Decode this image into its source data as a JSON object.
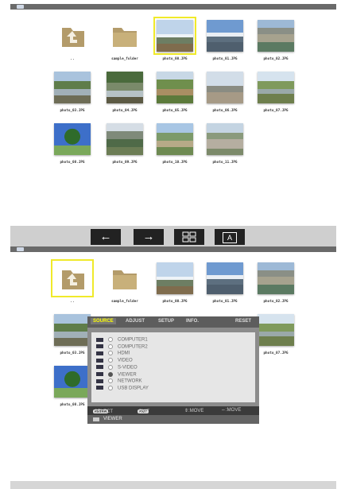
{
  "files_top": [
    {
      "label": "..",
      "kind": "up",
      "selected": false
    },
    {
      "label": "sample_folder",
      "kind": "folder",
      "selected": false
    },
    {
      "label": "photo_00.JPG",
      "kind": "photo",
      "scene": "mountain",
      "selected": true
    },
    {
      "label": "photo_01.JPG",
      "kind": "photo",
      "scene": "mountain-town",
      "selected": false
    },
    {
      "label": "photo_02.JPG",
      "kind": "photo",
      "scene": "bridge",
      "selected": false
    },
    {
      "label": "photo_03.JPG",
      "kind": "photo",
      "scene": "river",
      "selected": false
    },
    {
      "label": "photo_04.JPG",
      "kind": "photo",
      "scene": "forest-river",
      "selected": false
    },
    {
      "label": "photo_05.JPG",
      "kind": "photo",
      "scene": "vineyard",
      "selected": false
    },
    {
      "label": "photo_06.JPG",
      "kind": "photo",
      "scene": "power-lines",
      "selected": false
    },
    {
      "label": "photo_07.JPG",
      "kind": "photo",
      "scene": "stream",
      "selected": false
    },
    {
      "label": "photo_08.JPG",
      "kind": "photo",
      "scene": "tree",
      "selected": false
    },
    {
      "label": "photo_09.JPG",
      "kind": "photo",
      "scene": "hills",
      "selected": false
    },
    {
      "label": "photo_10.JPG",
      "kind": "photo",
      "scene": "valley",
      "selected": false
    },
    {
      "label": "photo_11.JPG",
      "kind": "photo",
      "scene": "city",
      "selected": false
    }
  ],
  "files_bottom": [
    {
      "label": "..",
      "kind": "up",
      "selected": true
    },
    {
      "label": "sample_folder",
      "kind": "folder",
      "selected": false
    },
    {
      "label": "photo_00.JPG",
      "kind": "photo",
      "scene": "mountain",
      "selected": false
    },
    {
      "label": "photo_01.JPG",
      "kind": "photo",
      "scene": "mountain-town",
      "selected": false
    },
    {
      "label": "photo_02.JPG",
      "kind": "photo",
      "scene": "bridge",
      "selected": false
    },
    {
      "label": "photo_03.JPG",
      "kind": "photo",
      "scene": "river",
      "selected": false
    },
    {
      "label": "photo_07.JPG",
      "kind": "photo",
      "scene": "stream",
      "selected": false
    },
    {
      "label": "photo_08.JPG",
      "kind": "photo",
      "scene": "tree",
      "selected": false
    }
  ],
  "navbar": {
    "buttons": [
      {
        "glyph": "←",
        "icon": "arrow-left-icon",
        "active": true
      },
      {
        "glyph": "→",
        "icon": "arrow-right-icon",
        "active": false
      },
      {
        "glyph": "",
        "icon": "grid-icon",
        "active": false
      },
      {
        "glyph": "A",
        "icon": "slideshow-icon",
        "active": false
      }
    ]
  },
  "osd": {
    "tabs": [
      "SOURCE",
      "ADJUST",
      "SETUP",
      "INFO.",
      "RESET"
    ],
    "active_tab": "SOURCE",
    "items": [
      {
        "label": "COMPUTER1",
        "icon": "monitor-icon",
        "selected": false
      },
      {
        "label": "COMPUTER2",
        "icon": "monitor-icon",
        "selected": false
      },
      {
        "label": "HDMI",
        "icon": "hdmi-icon",
        "selected": false
      },
      {
        "label": "VIDEO",
        "icon": "video-icon",
        "selected": false
      },
      {
        "label": "S-VIDEO",
        "icon": "svideo-icon",
        "selected": false
      },
      {
        "label": "VIEWER",
        "icon": "viewer-icon",
        "selected": true
      },
      {
        "label": "NETWORK",
        "icon": "network-icon",
        "selected": false
      },
      {
        "label": "USB DISPLAY",
        "icon": "usb-icon",
        "selected": false
      }
    ],
    "help": {
      "enter_key": "ENTER",
      "select": ":SELECT",
      "exit_key": "EXIT",
      "exit": ":EXIT",
      "move_v": "⇕:MOVE",
      "move_h": "⇔:MOVE"
    },
    "footer": "VIEWER"
  },
  "colors": {
    "selection": "#f0ea2a",
    "nav_active": "#ffff00",
    "folder": "#b39b6a"
  }
}
